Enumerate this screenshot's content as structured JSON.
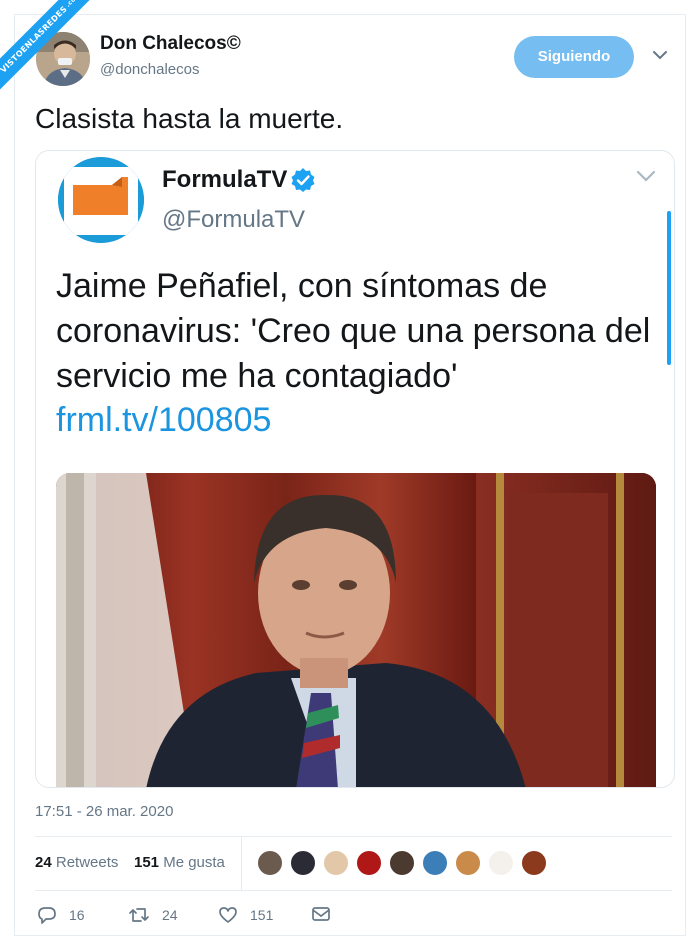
{
  "watermark": {
    "text": "VISTOENLASREDES",
    "suffix": ".com"
  },
  "author": {
    "name": "Don Chalecos©",
    "handle": "@donchalecos"
  },
  "follow_button": "Siguiendo",
  "tweet_text": "Clasista hasta la muerte.",
  "quoted": {
    "name": "FormulaTV",
    "handle": "@FormulaTV",
    "text": "Jaime Peñafiel, con síntomas de coronavirus: 'Creo que una persona del servicio me ha contagiado'",
    "link": "frml.tv/100805"
  },
  "timestamp": "17:51 - 26 mar. 2020",
  "stats": {
    "retweets_count": "24",
    "retweets_label": "Retweets",
    "likes_count": "151",
    "likes_label": "Me gusta"
  },
  "actions": {
    "replies": "16",
    "retweets": "24",
    "likes": "151"
  },
  "icons": [
    "chevron-down-icon",
    "verified-icon",
    "reply-icon",
    "retweet-icon",
    "heart-icon",
    "mail-icon"
  ],
  "colors": {
    "accent": "#1da1f2",
    "follow_bg": "#76bdf1",
    "link": "#1b95e0",
    "muted": "#657786"
  }
}
